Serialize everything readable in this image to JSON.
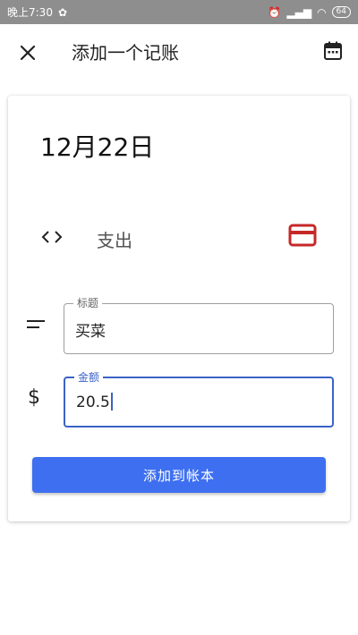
{
  "status_bar": {
    "time": "晚上7:30",
    "battery": "64"
  },
  "app_bar": {
    "title": "添加一个记账"
  },
  "form": {
    "date": "12月22日",
    "type_label": "支出",
    "title_field": {
      "label": "标题",
      "value": "买菜"
    },
    "amount_field": {
      "label": "金额",
      "value": "20.5"
    },
    "amount_symbol": "$",
    "submit_label": "添加到帐本"
  },
  "colors": {
    "accent": "#3d6ff0",
    "focus": "#3b63c5",
    "card_icon": "#c62828"
  },
  "icons": [
    "close-icon",
    "calendar-icon",
    "swap-icon",
    "credit-card-icon",
    "short-text-icon",
    "dollar-icon"
  ]
}
